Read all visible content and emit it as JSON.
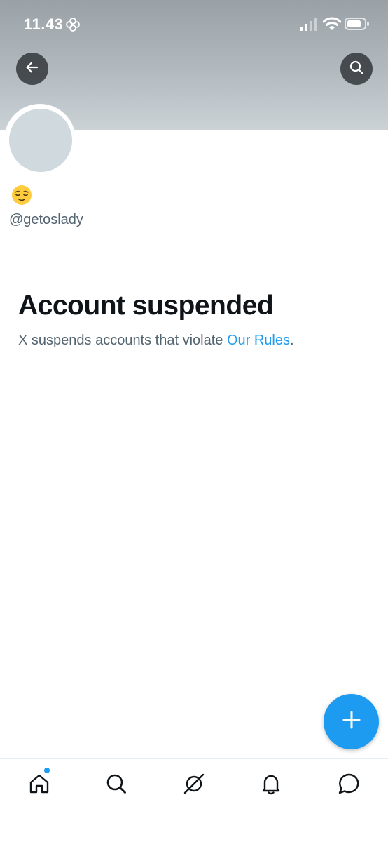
{
  "status_bar": {
    "time": "11.43",
    "flower_icon": "flower-icon",
    "signal_icon": "cellular-signal-icon",
    "wifi_icon": "wifi-icon",
    "battery_icon": "battery-icon"
  },
  "header": {
    "back_icon": "arrow-left-icon",
    "search_icon": "search-icon"
  },
  "profile": {
    "emoji": "😌",
    "handle": "@getoslady"
  },
  "suspension": {
    "title": "Account suspended",
    "text_before_link": "X suspends accounts that violate ",
    "link_text": "Our Rules",
    "text_after_link": "."
  },
  "fab": {
    "icon": "plus-icon"
  },
  "bottom_nav": {
    "items": [
      {
        "icon": "home-icon",
        "has_dot": true
      },
      {
        "icon": "search-icon"
      },
      {
        "icon": "grok-icon"
      },
      {
        "icon": "bell-icon"
      },
      {
        "icon": "message-bubble-icon"
      }
    ]
  },
  "colors": {
    "accent": "#1d9bf0",
    "text_primary": "#0f1419",
    "text_secondary": "#536471",
    "avatar_placeholder": "#cfd9de"
  }
}
